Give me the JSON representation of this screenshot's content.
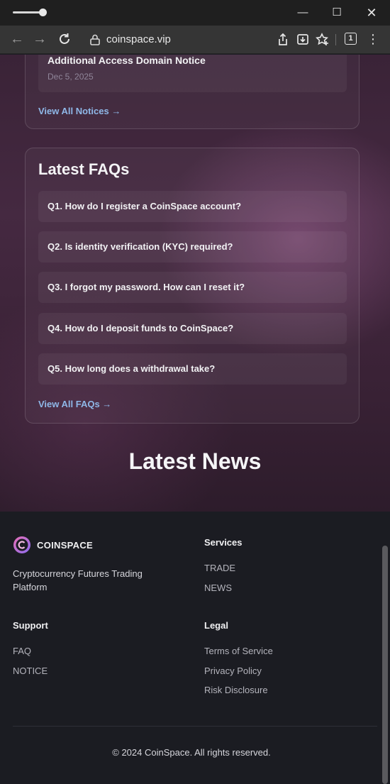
{
  "browser": {
    "url": "coinspace.vip",
    "tab_count": "1"
  },
  "notices": {
    "last_item": {
      "title": "Additional Access Domain Notice",
      "date": "Dec 5, 2025"
    },
    "view_all": "View All Notices →"
  },
  "faqs": {
    "heading": "Latest FAQs",
    "items": [
      {
        "question": "Q1. How do I register a CoinSpace account?"
      },
      {
        "question": "Q2. Is identity verification (KYC) required?"
      },
      {
        "question": "Q3. I forgot my password. How can I reset it?"
      },
      {
        "question": "Q4. How do I deposit funds to CoinSpace?"
      },
      {
        "question": "Q5. How long does a withdrawal take?"
      }
    ],
    "view_all": "View All FAQs →"
  },
  "news": {
    "heading": "Latest News"
  },
  "footer": {
    "brand": "COINSPACE",
    "tagline": "Cryptocurrency Futures Trading Platform",
    "services": {
      "heading": "Services",
      "links": [
        "TRADE",
        "NEWS"
      ]
    },
    "support": {
      "heading": "Support",
      "links": [
        "FAQ",
        "NOTICE"
      ]
    },
    "legal": {
      "heading": "Legal",
      "links": [
        "Terms of Service",
        "Privacy Policy",
        "Risk Disclosure"
      ]
    },
    "copyright": "© 2024 CoinSpace. All rights reserved."
  },
  "icons": {
    "back": "arrow-left-icon",
    "forward": "arrow-right-icon",
    "reload": "reload-icon",
    "site_info": "site-info-icon",
    "share": "share-icon",
    "install": "install-app-icon",
    "bookmark": "star-add-icon",
    "menu": "more-vert-icon"
  },
  "colors": {
    "link": "#8fb8e8",
    "footer_bg": "#1b1c22",
    "hero_bg": "#452941"
  }
}
